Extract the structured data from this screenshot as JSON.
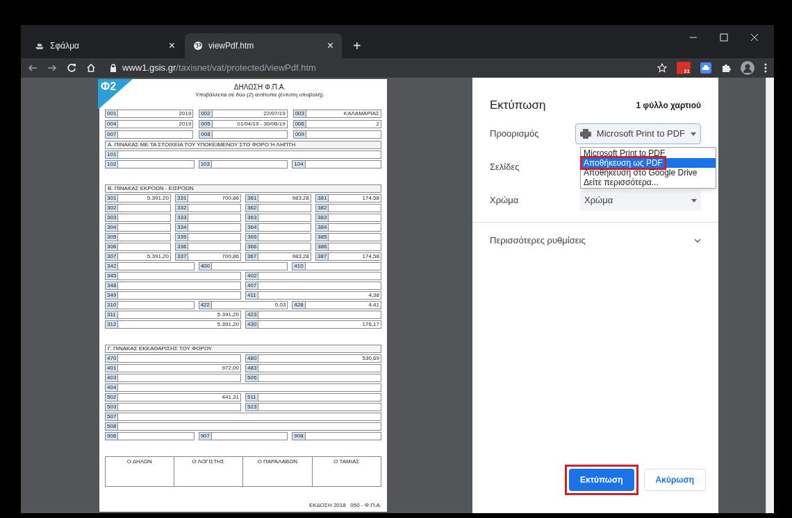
{
  "browser": {
    "tabs": [
      {
        "title": "Σφάλμα",
        "selected": false,
        "close": "×"
      },
      {
        "title": "viewPdf.htm",
        "selected": true,
        "close": "×"
      }
    ],
    "new_tab": "+",
    "url_host": "www1.gsis.gr",
    "url_path": "/taxisnet/vat/protected/viewPdf.htm",
    "calendar_badge": "31"
  },
  "document": {
    "logo": "Φ2",
    "title": "ΔΗΛΩΣΗ Φ.Π.Α.",
    "subtitle": "Υποβάλλεται σε δύο (2) αντίτυπα (έντυπη υποβολή).",
    "header_fields": [
      {
        "code": "001",
        "value": "2019"
      },
      {
        "code": "002",
        "value": "22/07/19"
      },
      {
        "code": "003",
        "value": "ΚΑΛΑΜΑΡΙΑΣ"
      },
      {
        "code": "004",
        "value": "2019"
      },
      {
        "code": "005",
        "value": "01/04/19 - 30/06/19"
      },
      {
        "code": "006",
        "value": "2"
      },
      {
        "code": "007"
      },
      {
        "code": "008"
      },
      {
        "code": "009"
      }
    ],
    "sections": [
      {
        "heading": "Α. ΠΙΝΑΚΑΣ ΜΕ ΤΑ ΣΤΟΙΧΕΙΑ ΤΟΥ ΥΠΟΚΕΙΜΕΝΟΥ ΣΤΟ ΦΟΡΟ Ή ΛΗΠΤΗ",
        "rows": [
          [
            {
              "code": "101"
            }
          ],
          [
            {
              "code": "102"
            },
            {
              "code": "103"
            },
            {
              "code": "104"
            }
          ]
        ]
      },
      {
        "heading": "Β. ΠΙΝΑΚΑΣ ΕΚΡΟΩΝ - ΕΙΣΡΟΩΝ",
        "rows": [
          [
            {
              "code": "301",
              "value": "5.391,20"
            },
            {
              "code": "331",
              "value": "700,86"
            },
            {
              "code": "361",
              "value": "983,28"
            },
            {
              "code": "381",
              "value": "174,58"
            }
          ],
          [
            {
              "code": "302"
            },
            {
              "code": "332"
            },
            {
              "code": "362"
            },
            {
              "code": "382"
            }
          ],
          [
            {
              "code": "303"
            },
            {
              "code": "333"
            },
            {
              "code": "363"
            },
            {
              "code": "383"
            }
          ],
          [
            {
              "code": "304"
            },
            {
              "code": "334"
            },
            {
              "code": "364"
            },
            {
              "code": "384"
            }
          ],
          [
            {
              "code": "305"
            },
            {
              "code": "335"
            },
            {
              "code": "365"
            },
            {
              "code": "385"
            }
          ],
          [
            {
              "code": "306"
            },
            {
              "code": "336"
            },
            {
              "code": "366"
            },
            {
              "code": "386"
            }
          ],
          [
            {
              "code": "307",
              "value": "5.391,20"
            },
            {
              "code": "337",
              "value": "700,86"
            },
            {
              "code": "367",
              "value": "983,28"
            },
            {
              "code": "387",
              "value": "174,58"
            }
          ],
          [
            {
              "code": "342"
            },
            {
              "code": "400"
            },
            {
              "code": "410"
            }
          ],
          [
            {
              "code": "345"
            },
            {
              "code": "402"
            }
          ],
          [
            {
              "code": "348"
            },
            {
              "code": "407"
            }
          ],
          [
            {
              "code": "349"
            },
            {
              "code": "411",
              "value": "4,38"
            }
          ],
          [
            {
              "code": "310"
            },
            {
              "code": "422",
              "value": "0,03"
            },
            {
              "code": "428",
              "value": "4,41"
            }
          ],
          [
            {
              "code": "311",
              "value": "5.391,20"
            },
            {
              "code": "423"
            }
          ],
          [
            {
              "code": "312",
              "value": "5.391,20"
            },
            {
              "code": "430",
              "value": "176,17"
            }
          ]
        ]
      },
      {
        "heading": "Γ. ΠΙΝΑΚΑΣ ΕΚΚΑΘΑΡΙΣΗΣ ΤΟΥ ΦΟΡΟΥ",
        "rows": [
          [
            {
              "code": "470"
            },
            {
              "code": "480",
              "value": "530,69"
            }
          ],
          [
            {
              "code": "401",
              "value": "972,00"
            },
            {
              "code": "483"
            }
          ],
          [
            {
              "code": "403"
            },
            {
              "code": "505"
            }
          ],
          [
            {
              "code": "404"
            }
          ],
          [
            {
              "code": "502",
              "value": "441,31"
            },
            {
              "code": "511"
            }
          ],
          [
            {
              "code": "503"
            },
            {
              "code": "523"
            }
          ],
          [
            {
              "code": "507"
            }
          ],
          [
            {
              "code": "508"
            }
          ],
          [
            {
              "code": "906"
            },
            {
              "code": "907"
            },
            {
              "code": "908"
            }
          ]
        ]
      }
    ],
    "signatures": [
      "Ο ΔΗΛΩΝ",
      "Ο ΛΟΓΙΣΤΗΣ",
      "Ο ΠΑΡΑΛΑΒΩΝ",
      "Ο ΤΑΜΙΑΣ"
    ],
    "edition": "ΕΚΔΟΣΗ 2018   050 - Φ.Π.Α."
  },
  "print_panel": {
    "title": "Εκτύπωση",
    "sheets": "1 φύλλο χαρτιού",
    "settings": [
      {
        "label": "Προορισμός",
        "kind": "destination",
        "value": "Microsoft Print to PDF"
      },
      {
        "label": "Σελίδες",
        "kind": "covered"
      },
      {
        "label": "Χρώμα",
        "kind": "select",
        "value": "Χρώμα"
      }
    ],
    "destination_menu": [
      {
        "label": "Microsoft Print to PDF",
        "selected": false,
        "marked": false
      },
      {
        "label": "Αποθήκευση ως PDF",
        "selected": true,
        "marked": true
      },
      {
        "label": "Αποθήκευση στο Google Drive",
        "selected": false,
        "marked": false
      },
      {
        "label": "Δείτε περισσότερα...",
        "selected": false,
        "marked": false
      }
    ],
    "more_settings": "Περισσότερες ρυθμίσεις",
    "buttons": [
      {
        "label": "Εκτύπωση",
        "kind": "primary",
        "marked": true
      },
      {
        "label": "Ακύρωση",
        "kind": "secondary",
        "marked": false
      }
    ]
  }
}
